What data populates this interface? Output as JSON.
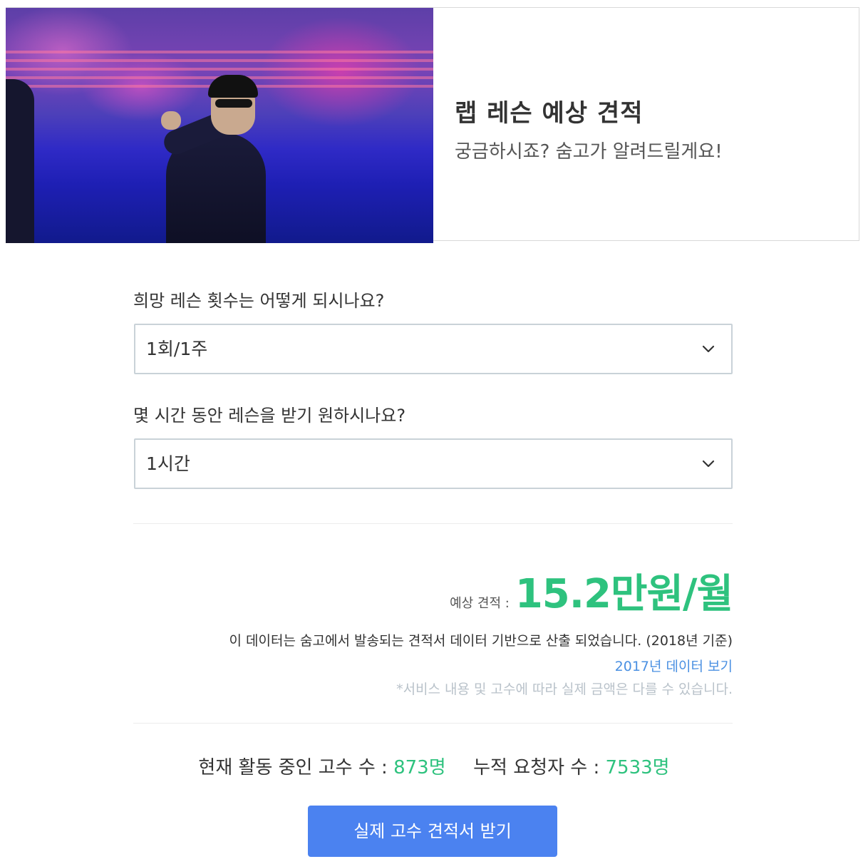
{
  "hero": {
    "title": "랩 레슨 예상 견적",
    "subtitle": "궁금하시죠? 숨고가 알려드릴게요!"
  },
  "form": {
    "frequency_question": "희망 레슨 횟수는 어떻게 되시나요?",
    "frequency_value": "1회/1주",
    "duration_question": "몇 시간 동안 레슨을 받기 원하시나요?",
    "duration_value": "1시간"
  },
  "estimate": {
    "label": "예상 견적 :",
    "value": "15.2만원/월",
    "basis_note": "이 데이터는 숨고에서 발송되는 견적서 데이터 기반으로 산출 되었습니다. (2018년 기준)",
    "past_data_link": "2017년 데이터 보기",
    "disclaimer": "*서비스 내용 및 고수에 따라 실제 금액은 다를 수 있습니다."
  },
  "stats": {
    "active_pros_label": "현재 활동 중인 고수 수 :",
    "active_pros_value": "873명",
    "total_requests_label": "누적 요청자 수 :",
    "total_requests_value": "7533명"
  },
  "cta": {
    "label": "실제 고수 견적서 받기"
  },
  "colors": {
    "accent_green": "#2ec27e",
    "link_blue": "#4a90e2",
    "cta_blue": "#4b82f0",
    "border": "#c9d2d8"
  },
  "icons": {
    "dropdown": "chevron-down-icon"
  }
}
